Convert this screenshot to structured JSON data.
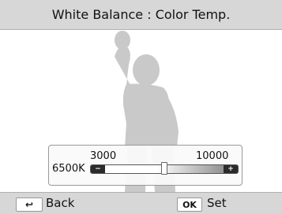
{
  "title": "White Balance : Color Temp.",
  "slider": {
    "min_label": "3000",
    "max_label": "10000",
    "current_label": "6500K",
    "minus_symbol": "−",
    "plus_symbol": "+",
    "value": 6500,
    "min": 3000,
    "max": 10000
  },
  "footer": {
    "back_icon": "↩",
    "back_label": "Back",
    "ok_key": "OK",
    "set_label": "Set"
  }
}
